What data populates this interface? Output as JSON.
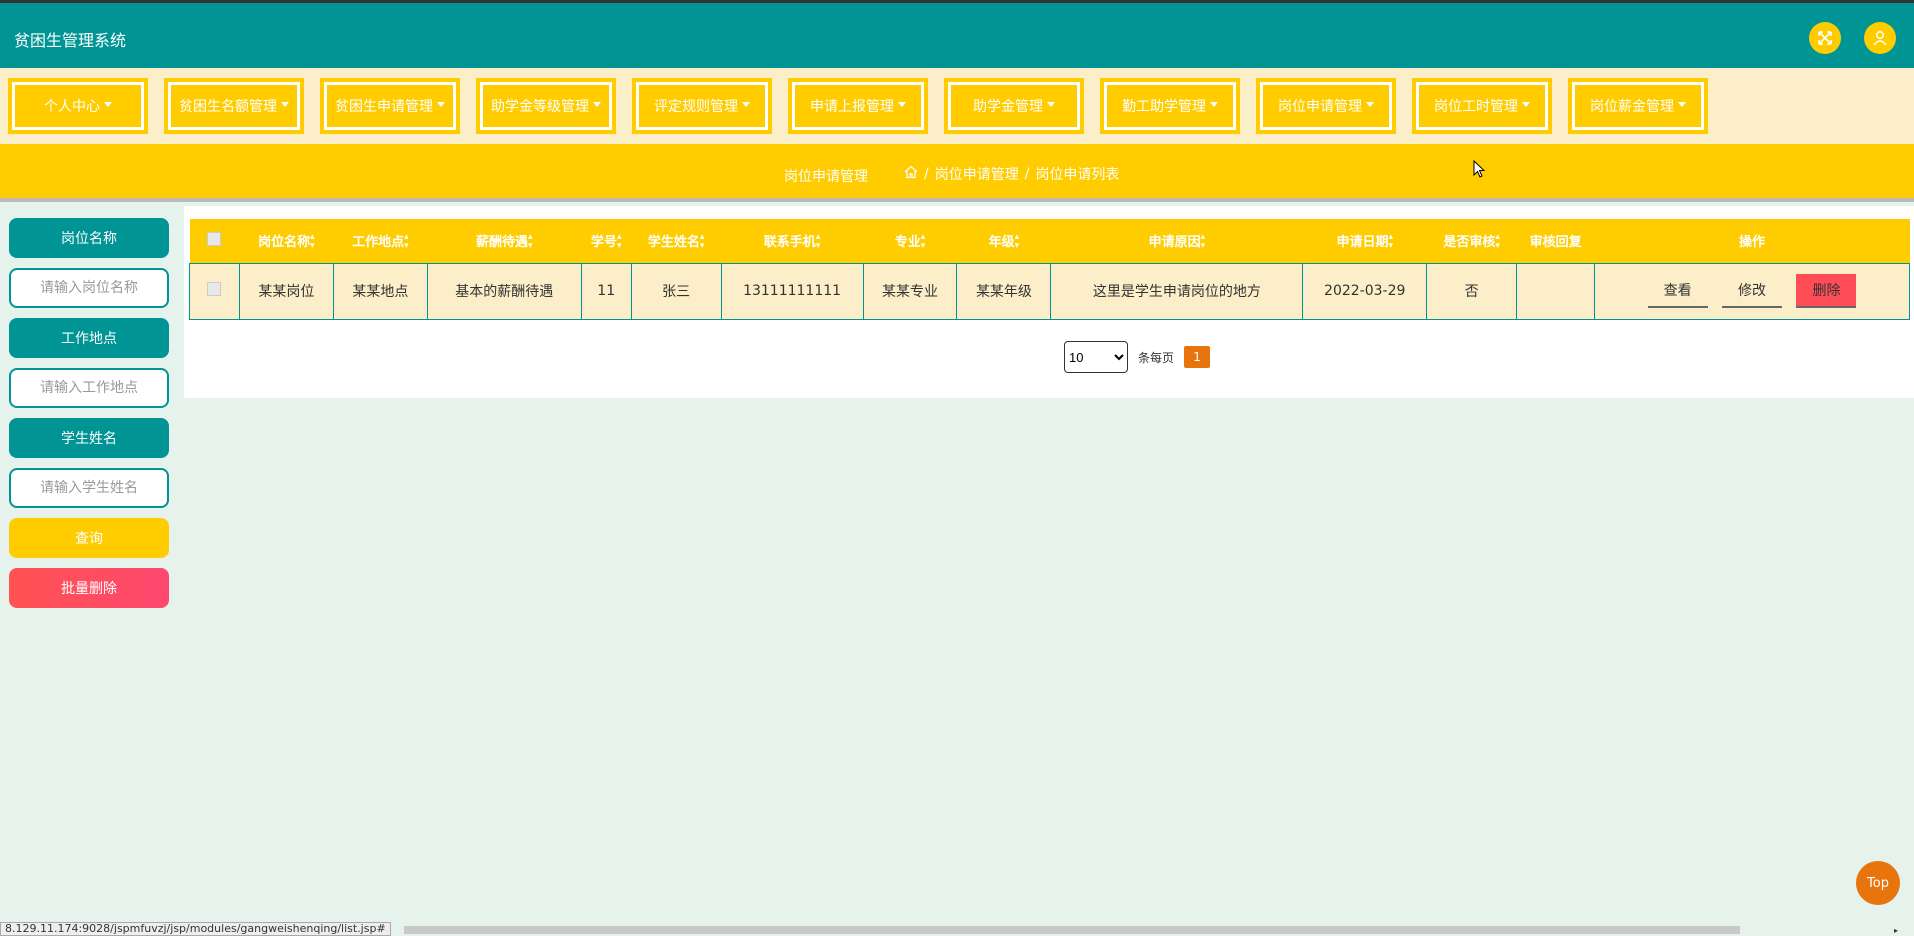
{
  "app": {
    "title": "贫困生管理系统"
  },
  "header_icons": {
    "fullscreen": "fullscreen-icon",
    "user": "user-icon"
  },
  "nav": [
    "个人中心",
    "贫困生名额管理",
    "贫困生申请管理",
    "助学金等级管理",
    "评定规则管理",
    "申请上报管理",
    "助学金管理",
    "勤工助学管理",
    "岗位申请管理",
    "岗位工时管理",
    "岗位薪金管理"
  ],
  "breadcrumb": {
    "title": "岗位申请管理",
    "path": [
      "岗位申请管理",
      "岗位申请列表"
    ],
    "separator": "/"
  },
  "sidebar": {
    "job_name_label": "岗位名称",
    "job_name_placeholder": "请输入岗位名称",
    "location_label": "工作地点",
    "location_placeholder": "请输入工作地点",
    "student_name_label": "学生姓名",
    "student_name_placeholder": "请输入学生姓名",
    "query_button": "查询",
    "batch_delete_button": "批量删除"
  },
  "table": {
    "headers": [
      "岗位名称",
      "工作地点",
      "薪酬待遇",
      "学号",
      "学生姓名",
      "联系手机",
      "专业",
      "年级",
      "申请原因",
      "申请日期",
      "是否审核",
      "审核回复",
      "操作"
    ],
    "rows": [
      [
        "某某岗位",
        "某某地点",
        "基本的薪酬待遇",
        "11",
        "张三",
        "13111111111",
        "某某专业",
        "某某年级",
        "这里是学生申请岗位的地方",
        "2022-03-29",
        "否",
        ""
      ]
    ],
    "actions": {
      "view": "查看",
      "edit": "修改",
      "delete": "删除"
    }
  },
  "pagination": {
    "page_size": "10",
    "per_page_label": "条每页",
    "current_page": "1"
  },
  "top_button": "Top",
  "status_url": "8.129.11.174:9028/jspmfuvzj/jsp/modules/gangweishenqing/list.jsp#",
  "colors": {
    "teal": "#009494",
    "yellow": "#ffcc00",
    "cream": "#fbeec8",
    "orange": "#e8740e",
    "red": "#ff4d57"
  }
}
